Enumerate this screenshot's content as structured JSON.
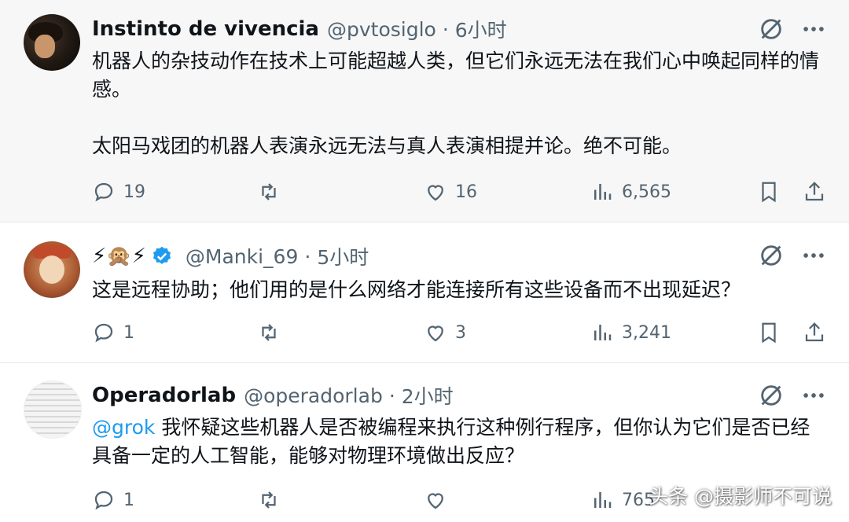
{
  "tweets": [
    {
      "author_name": "Instinto de vivencia",
      "handle": "@pvtosiglo",
      "time": "6小时",
      "body_lines": [
        "机器人的杂技动作在技术上可能超越人类，但它们永远无法在我们心中唤起同样的情感。",
        "太阳马戏团的机器人表演永远无法与真人表演相提并论。绝不可能。"
      ],
      "replies": "19",
      "retweets": "",
      "likes": "16",
      "views": "6,565"
    },
    {
      "author_emojis": "⚡🙊⚡",
      "handle": "@Manki_69",
      "time": "5小时",
      "body": "这是远程协助；他们用的是什么网络才能连接所有这些设备而不出现延迟？",
      "replies": "1",
      "retweets": "",
      "likes": "3",
      "views": "3,241"
    },
    {
      "author_name": "Operadorlab",
      "handle": "@operadorlab",
      "time": "2小时",
      "mention": "@grok",
      "body": " 我怀疑这些机器人是否被编程来执行这种例行程序，但你认为它们是否已经具备一定的人工智能，能够对物理环境做出反应？",
      "replies": "1",
      "retweets": "",
      "likes": "",
      "views": "765"
    }
  ],
  "separator": "·",
  "watermark": "头条 @摄影师不可说",
  "colors": {
    "text": "#0f1419",
    "secondary": "#536471",
    "mention": "#1d9bf0",
    "verified": "#1d9bf0",
    "highlight_bg": "#f7f7f7"
  },
  "icons": [
    "reply-icon",
    "retweet-icon",
    "like-icon",
    "views-icon",
    "bookmark-icon",
    "share-icon",
    "grok-icon",
    "more-icon",
    "verified-badge-icon"
  ]
}
